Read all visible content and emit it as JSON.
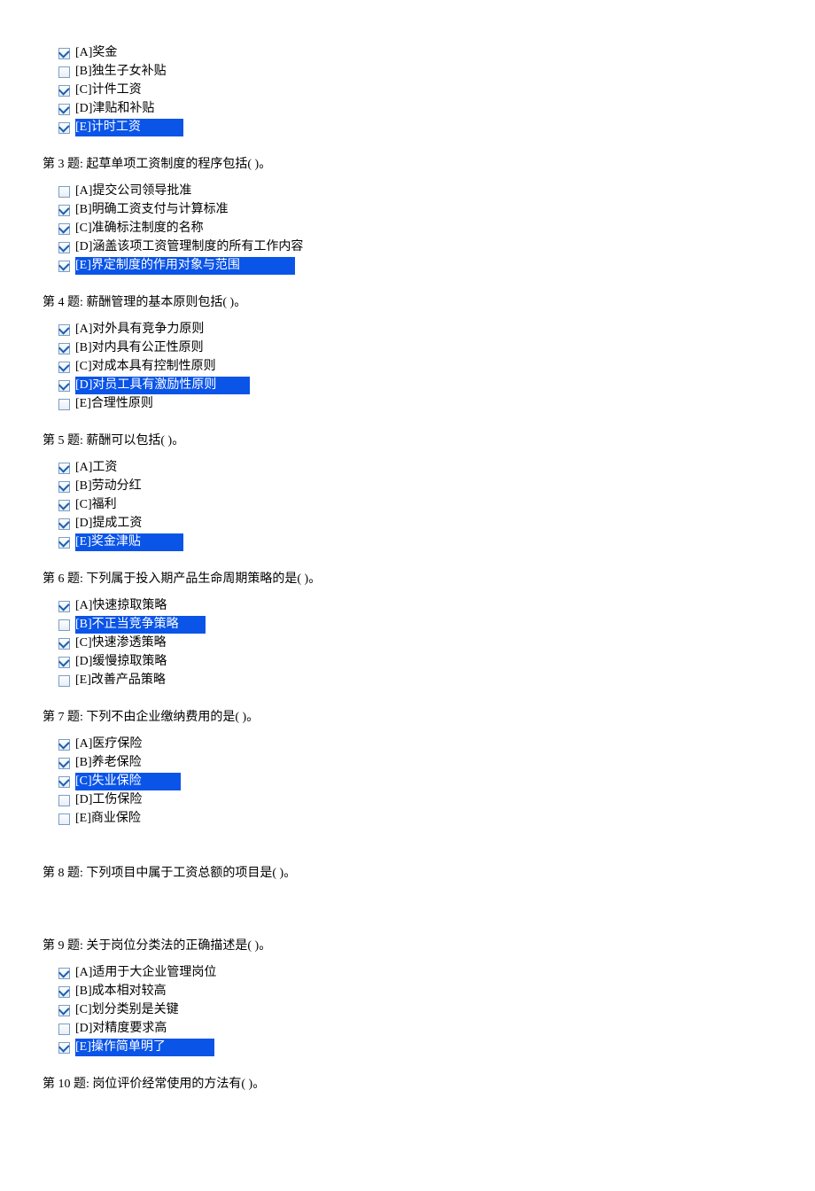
{
  "questions": [
    {
      "title": "",
      "options": [
        {
          "checked": true,
          "highlighted": false,
          "label": "[A]奖金"
        },
        {
          "checked": false,
          "highlighted": false,
          "label": "[B]独生子女补贴"
        },
        {
          "checked": true,
          "highlighted": false,
          "label": "[C]计件工资"
        },
        {
          "checked": true,
          "highlighted": false,
          "label": "[D]津贴和补贴"
        },
        {
          "checked": true,
          "highlighted": true,
          "label": "[E]计时工资            "
        }
      ]
    },
    {
      "title": "第 3 题:    起草单项工资制度的程序包括(    )。",
      "options": [
        {
          "checked": false,
          "highlighted": false,
          "label": "[A]提交公司领导批准"
        },
        {
          "checked": true,
          "highlighted": false,
          "label": "[B]明确工资支付与计算标准"
        },
        {
          "checked": true,
          "highlighted": false,
          "label": "[C]准确标注制度的名称"
        },
        {
          "checked": true,
          "highlighted": false,
          "label": "[D]涵盖该项工资管理制度的所有工作内容"
        },
        {
          "checked": true,
          "highlighted": true,
          "label": "[E]界定制度的作用对象与范围                "
        }
      ]
    },
    {
      "title": "第 4 题:    薪酬管理的基本原则包括(    )。",
      "options": [
        {
          "checked": true,
          "highlighted": false,
          "label": "[A]对外具有竞争力原则"
        },
        {
          "checked": true,
          "highlighted": false,
          "label": "[B]对内具有公正性原则"
        },
        {
          "checked": true,
          "highlighted": false,
          "label": "[C]对成本具有控制性原则"
        },
        {
          "checked": true,
          "highlighted": true,
          "label": "[D]对员工具有激励性原则         "
        },
        {
          "checked": false,
          "highlighted": false,
          "label": "[E]合理性原则"
        }
      ]
    },
    {
      "title": "第 5 题:    薪酬可以包括(    )。",
      "options": [
        {
          "checked": true,
          "highlighted": false,
          "label": "[A]工资"
        },
        {
          "checked": true,
          "highlighted": false,
          "label": "[B]劳动分红"
        },
        {
          "checked": true,
          "highlighted": false,
          "label": "[C]福利"
        },
        {
          "checked": true,
          "highlighted": false,
          "label": "[D]提成工资"
        },
        {
          "checked": true,
          "highlighted": true,
          "label": "[E]奖金津贴            "
        }
      ]
    },
    {
      "title": "第 6 题:    下列属于投入期产品生命周期策略的是(    )。",
      "options": [
        {
          "checked": true,
          "highlighted": false,
          "label": "[A]快速掠取策略"
        },
        {
          "checked": false,
          "highlighted": true,
          "label": "[B]不正当竞争策略       "
        },
        {
          "checked": true,
          "highlighted": false,
          "label": "[C]快速渗透策略"
        },
        {
          "checked": true,
          "highlighted": false,
          "label": "[D]缓慢掠取策略"
        },
        {
          "checked": false,
          "highlighted": false,
          "label": "[E]改善产品策略"
        }
      ]
    },
    {
      "title": "第 7 题:    下列不由企业缴纳费用的是(    )。",
      "options": [
        {
          "checked": true,
          "highlighted": false,
          "label": "[A]医疗保险"
        },
        {
          "checked": true,
          "highlighted": false,
          "label": "[B]养老保险"
        },
        {
          "checked": true,
          "highlighted": true,
          "label": "[C]失业保险           "
        },
        {
          "checked": false,
          "highlighted": false,
          "label": "[D]工伤保险"
        },
        {
          "checked": false,
          "highlighted": false,
          "label": "[E]商业保险"
        }
      ]
    },
    {
      "title": "第 8 题:    下列项目中属于工资总额的项目是(    )。",
      "options": []
    },
    {
      "title": "第 9 题:    关于岗位分类法的正确描述是(    )。",
      "options": [
        {
          "checked": true,
          "highlighted": false,
          "label": "[A]适用于大企业管理岗位"
        },
        {
          "checked": true,
          "highlighted": false,
          "label": "[B]成本相对较高"
        },
        {
          "checked": true,
          "highlighted": false,
          "label": "[C]划分类别是关键"
        },
        {
          "checked": false,
          "highlighted": false,
          "label": "[D]对精度要求高"
        },
        {
          "checked": true,
          "highlighted": true,
          "label": "[E]操作简单明了              "
        }
      ]
    },
    {
      "title": "第 10 题:    岗位评价经常使用的方法有(    )。",
      "options": []
    }
  ]
}
